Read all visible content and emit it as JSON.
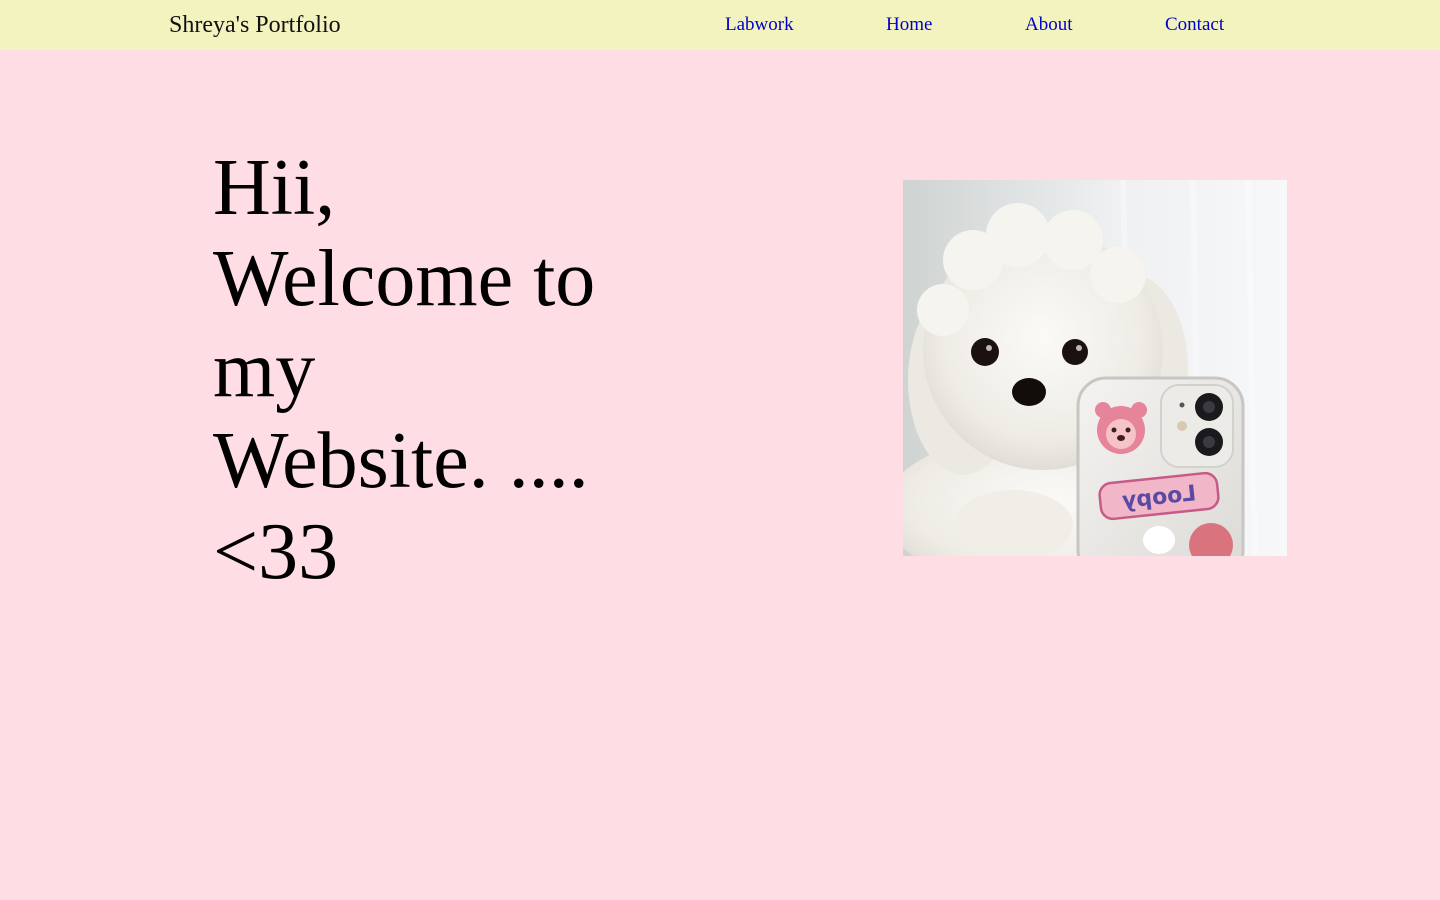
{
  "header": {
    "brand": "Shreya's Portfolio",
    "nav": [
      {
        "label": "Labwork"
      },
      {
        "label": "Home"
      },
      {
        "label": "About"
      },
      {
        "label": "Contact"
      }
    ]
  },
  "hero": {
    "lines": [
      "Hii,",
      "Welcome to",
      "my",
      "Website. ....",
      "<33"
    ]
  },
  "photo": {
    "phone_sticker_text": "Loopy"
  },
  "colors": {
    "page_background": "#ffdde5",
    "navbar_background": "#f3f3bf",
    "link": "#0000cc",
    "text": "#000000"
  }
}
